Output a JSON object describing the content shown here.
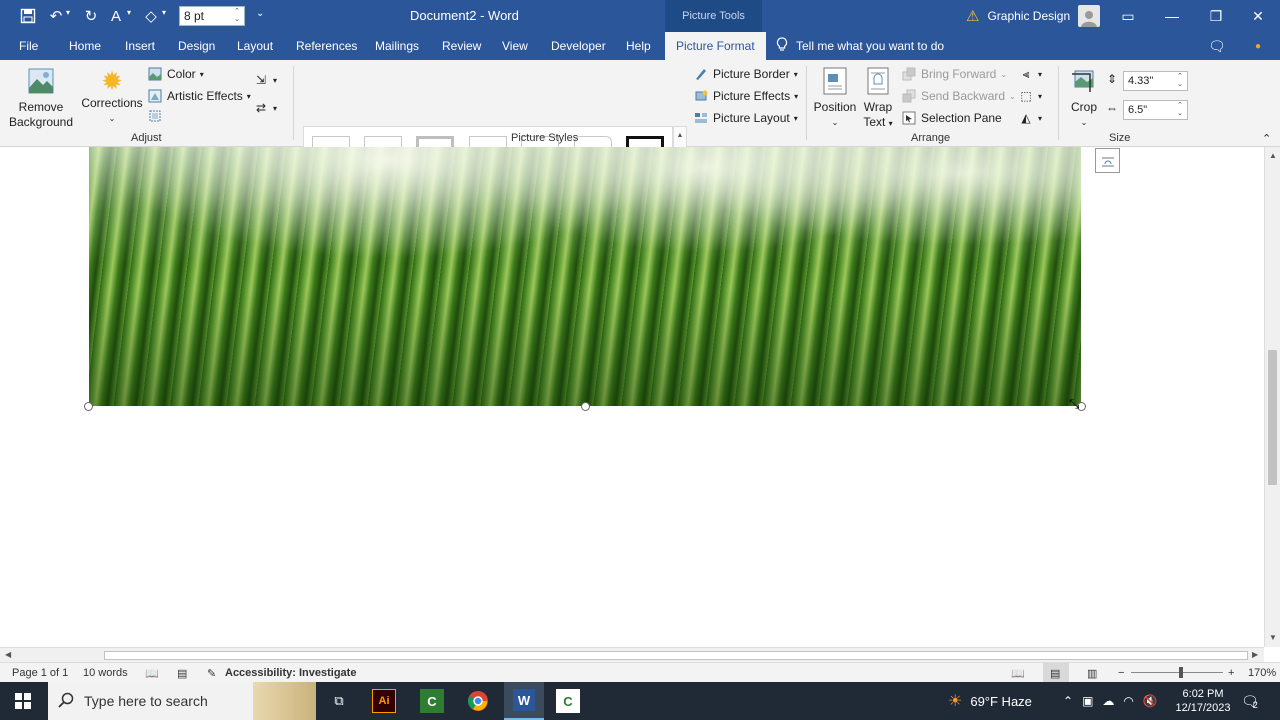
{
  "titlebar": {
    "font_size_value": "8 pt",
    "document_title": "Document2  -  Word",
    "context_tab_group": "Picture Tools",
    "account_name": "Graphic Design",
    "warning_icon": "warning-triangle-icon"
  },
  "tabs": [
    "File",
    "Home",
    "Insert",
    "Design",
    "Layout",
    "References",
    "Mailings",
    "Review",
    "View",
    "Developer",
    "Help",
    "Picture Format"
  ],
  "active_tab": "Picture Format",
  "tell_me": "Tell me what you want to do",
  "ribbon": {
    "adjust": {
      "label": "Adjust",
      "remove_background_1": "Remove",
      "remove_background_2": "Background",
      "corrections": "Corrections",
      "color": "Color",
      "artistic_effects": "Artistic Effects"
    },
    "picture_styles": {
      "label": "Picture Styles",
      "picture_border": "Picture Border",
      "picture_effects": "Picture Effects",
      "picture_layout": "Picture Layout"
    },
    "arrange": {
      "label": "Arrange",
      "position": "Position",
      "wrap_text_1": "Wrap",
      "wrap_text_2": "Text",
      "bring_forward": "Bring Forward",
      "send_backward": "Send Backward",
      "selection_pane": "Selection Pane"
    },
    "size": {
      "label": "Size",
      "crop": "Crop",
      "height": "4.33\"",
      "width": "6.5\""
    }
  },
  "statusbar": {
    "page": "Page 1 of 1",
    "words": "10 words",
    "accessibility": "Accessibility: Investigate",
    "zoom": "170%"
  },
  "taskbar": {
    "search_placeholder": "Type here to search",
    "weather": "69°F  Haze",
    "time": "6:02 PM",
    "date": "12/17/2023",
    "notification_count": "2"
  },
  "colors": {
    "word_blue": "#2b579a",
    "ribbon_bg": "#f3f3f3",
    "taskbar_bg": "#1f2a36"
  }
}
